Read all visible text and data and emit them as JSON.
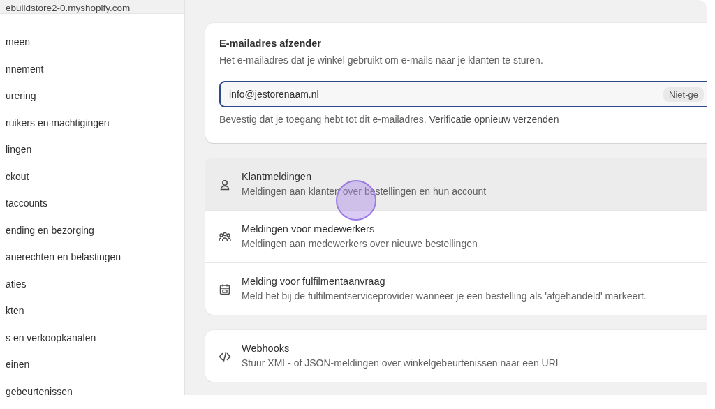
{
  "sidebar": {
    "store": "ebuildstore2-0.myshopify.com",
    "items": [
      {
        "label": "meen"
      },
      {
        "label": "nnement"
      },
      {
        "label": "urering"
      },
      {
        "label": "ruikers en machtigingen"
      },
      {
        "label": "lingen"
      },
      {
        "label": "ckout"
      },
      {
        "label": "taccounts"
      },
      {
        "label": "ending en bezorging"
      },
      {
        "label": "anerechten en belastingen"
      },
      {
        "label": "aties"
      },
      {
        "label": "kten"
      },
      {
        "label": "s en verkoopkanalen"
      },
      {
        "label": "einen"
      },
      {
        "label": "gebeurtenissen"
      }
    ]
  },
  "sender_card": {
    "title": "E-mailadres afzender",
    "description": "Het e-mailadres dat je winkel gebruikt om e-mails naar je klanten te sturen.",
    "email_field": {
      "value": "info@jestorenaam.nl",
      "badge": "Niet-ge"
    },
    "help_text": "Bevestig dat je toegang hebt tot dit e-mailadres.",
    "help_link": "Verificatie opnieuw verzenden"
  },
  "notification_groups": [
    {
      "rows": [
        {
          "kind": "person",
          "title": "Klantmeldingen",
          "description": "Meldingen aan klanten over bestellingen en hun account",
          "highlighted": true
        },
        {
          "kind": "people",
          "title": "Meldingen voor medewerkers",
          "description": "Meldingen aan medewerkers over nieuwe bestellingen",
          "highlighted": false
        },
        {
          "kind": "box",
          "title": "Melding voor fulfilmentaanvraag",
          "description": "Meld het bij de fulfilmentserviceprovider wanneer je een bestelling als 'afgehandeld' markeert.",
          "highlighted": false
        }
      ]
    },
    {
      "rows": [
        {
          "kind": "code",
          "title": "Webhooks",
          "description": "Stuur XML- of JSON-meldingen over winkelgebeurtenissen naar een URL",
          "highlighted": false
        }
      ]
    }
  ]
}
